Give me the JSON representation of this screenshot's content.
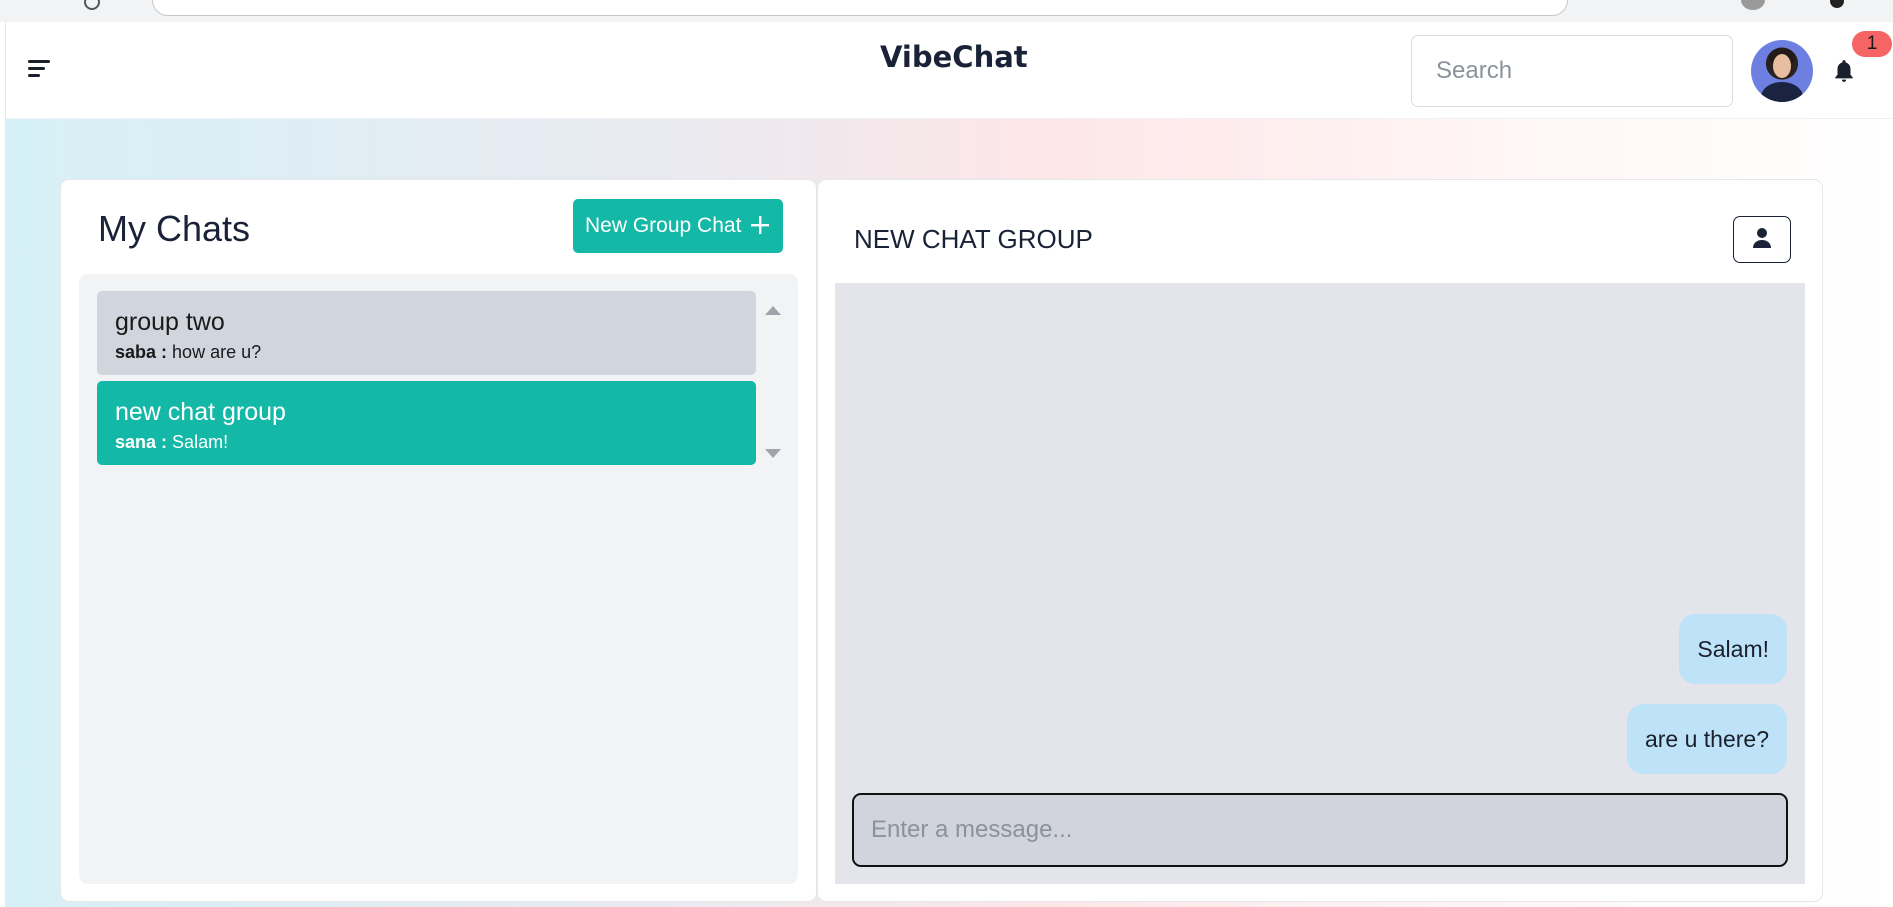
{
  "app": {
    "title": "VibeChat",
    "search_placeholder": "Search",
    "notification_count": "1"
  },
  "sidebar": {
    "title": "My Chats",
    "new_group_label": "New Group Chat",
    "chats": [
      {
        "name": "group two",
        "sender": "saba :",
        "preview": "how are u?",
        "selected": false
      },
      {
        "name": "new chat group",
        "sender": "sana :",
        "preview": "Salam!",
        "selected": true
      }
    ]
  },
  "chat": {
    "title": "NEW CHAT GROUP",
    "messages": [
      {
        "text": "Salam!"
      },
      {
        "text": "are u there?"
      }
    ],
    "input_placeholder": "Enter a message..."
  },
  "colors": {
    "accent": "#14b8a6",
    "message_bubble": "#bee3f8",
    "badge": "#f56565"
  },
  "icons": [
    "menu-icon",
    "bell-icon",
    "plus-icon",
    "user-icon",
    "scroll-up-icon",
    "scroll-down-icon"
  ]
}
